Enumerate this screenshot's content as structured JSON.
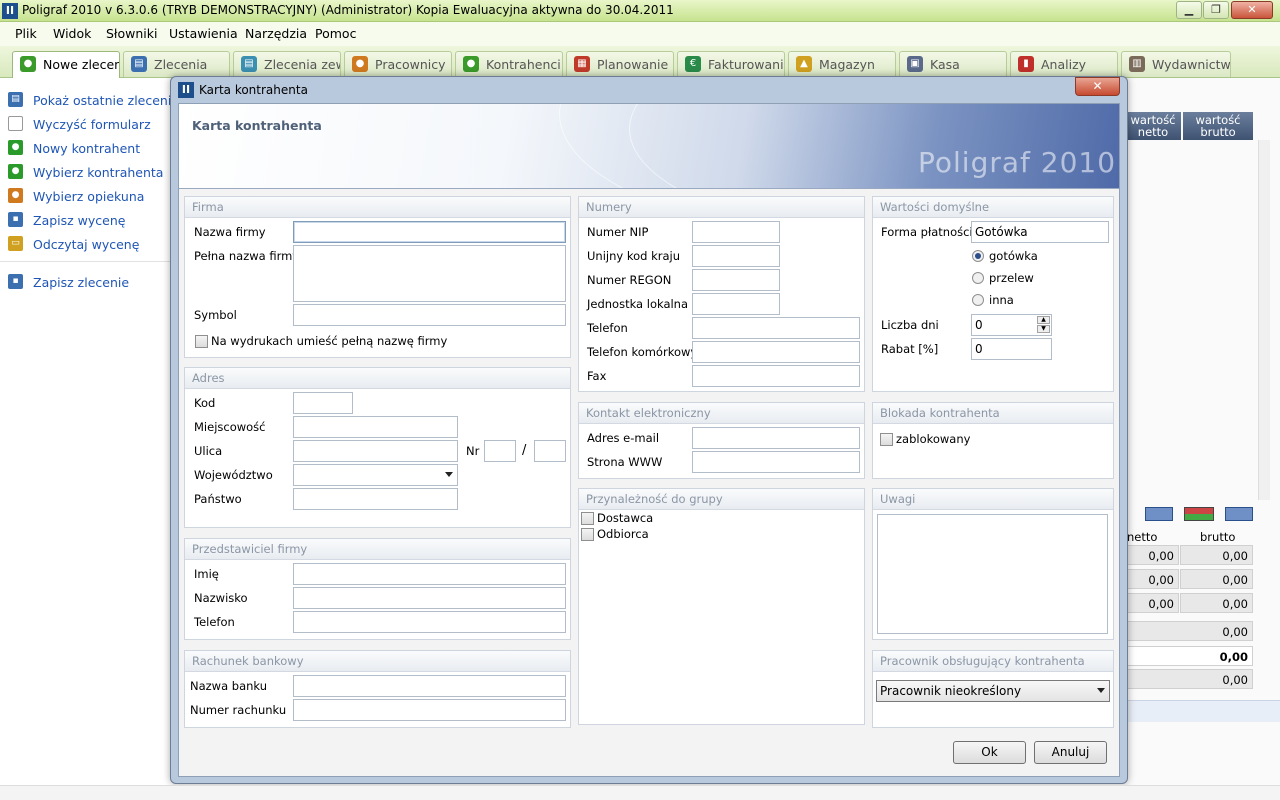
{
  "window": {
    "title": "Poligraf 2010 v 6.3.0.6 (TRYB DEMONSTRACYJNY) (Administrator) Kopia Ewaluacyjna aktywna do 30.04.2011",
    "app_icon": "II",
    "minimize": "▁",
    "maximize": "❐",
    "close": "✕"
  },
  "menu": [
    "Plik",
    "Widok",
    "Słowniki",
    "Ustawienia",
    "Narzędzia",
    "Pomoc"
  ],
  "tabs": [
    {
      "label": "Nowe zlecenie",
      "icon": "people-icon",
      "color": "#3a9a2a"
    },
    {
      "label": "Zlecenia",
      "icon": "documents-icon",
      "color": "#3b6fb0"
    },
    {
      "label": "Zlecenia zewn.",
      "icon": "external-documents-icon",
      "color": "#3b8fb0"
    },
    {
      "label": "Pracownicy",
      "icon": "workers-icon",
      "color": "#d07a20"
    },
    {
      "label": "Kontrahenci",
      "icon": "contractors-icon",
      "color": "#3a9a2a"
    },
    {
      "label": "Planowanie",
      "icon": "planning-icon",
      "color": "#c03a2a"
    },
    {
      "label": "Fakturowanie",
      "icon": "invoice-icon",
      "color": "#2a8a4a"
    },
    {
      "label": "Magazyn",
      "icon": "warehouse-icon",
      "color": "#d0a020"
    },
    {
      "label": "Kasa",
      "icon": "cash-icon",
      "color": "#5a6a8a"
    },
    {
      "label": "Analizy",
      "icon": "chart-icon",
      "color": "#c0302a"
    },
    {
      "label": "Wydawnictwo",
      "icon": "book-icon",
      "color": "#7a6a5a"
    }
  ],
  "sidebar": [
    {
      "label": "Pokaż ostatnie zlecenie",
      "icon": "recent-documents-icon",
      "color": "#3b6fb0"
    },
    {
      "label": "Wyczyść formularz",
      "icon": "blank-page-icon",
      "color": "#ffffff"
    },
    {
      "label": "Nowy kontrahent",
      "icon": "person-icon",
      "color": "#2a9a2a"
    },
    {
      "label": "Wybierz kontrahenta",
      "icon": "people-icon",
      "color": "#2a9a2a"
    },
    {
      "label": "Wybierz opiekuna",
      "icon": "workers-icon",
      "color": "#d07a20"
    },
    {
      "label": "Zapisz wycenę",
      "icon": "floppy-icon",
      "color": "#3b6fb0"
    },
    {
      "label": "Odczytaj wycenę",
      "icon": "open-folder-icon",
      "color": "#d0a020"
    },
    {
      "label": "Zapisz zlecenie",
      "icon": "floppy-icon",
      "color": "#3b6fb0"
    }
  ],
  "right_panel": {
    "col_netto": "wartość netto",
    "col_brutto": "wartość brutto",
    "sub_netto": "netto",
    "sub_brutto": "brutto",
    "rows": [
      {
        "netto": "0,00",
        "brutto": "0,00"
      },
      {
        "netto": "0,00",
        "brutto": "0,00"
      },
      {
        "netto": "0,00",
        "brutto": "0,00"
      },
      {
        "netto": "",
        "brutto": "0,00"
      },
      {
        "netto": "",
        "brutto": "0,00"
      },
      {
        "netto": "",
        "brutto": "0,00"
      }
    ]
  },
  "dialog": {
    "title": "Karta kontrahenta",
    "banner_title": "Karta kontrahenta",
    "banner_logo": "Poligraf 2010",
    "close": "✕",
    "ok": "Ok",
    "cancel": "Anuluj"
  },
  "firma": {
    "header": "Firma",
    "nazwa_label": "Nazwa firmy",
    "nazwa_value": "",
    "pelna_label": "Pełna nazwa firmy",
    "symbol_label": "Symbol",
    "print_full_label": "Na wydrukach umieść pełną nazwę firmy"
  },
  "adres": {
    "header": "Adres",
    "kod_label": "Kod",
    "miejscowosc_label": "Miejscowość",
    "ulica_label": "Ulica",
    "nr_label": "Nr",
    "slash": "/",
    "wojewodztwo_label": "Województwo",
    "panstwo_label": "Państwo"
  },
  "przedstawiciel": {
    "header": "Przedstawiciel firmy",
    "imie_label": "Imię",
    "nazwisko_label": "Nazwisko",
    "telefon_label": "Telefon"
  },
  "bank": {
    "header": "Rachunek bankowy",
    "nazwa_label": "Nazwa banku",
    "numer_label": "Numer rachunku"
  },
  "numery": {
    "header": "Numery",
    "nip_label": "Numer NIP",
    "kod_kraju_label": "Unijny kod kraju",
    "regon_label": "Numer REGON",
    "jednostka_label": "Jednostka lokalna",
    "telefon_label": "Telefon",
    "komorkowy_label": "Telefon komórkowy",
    "fax_label": "Fax"
  },
  "kontakt": {
    "header": "Kontakt elektroniczny",
    "email_label": "Adres e-mail",
    "www_label": "Strona WWW"
  },
  "grupa": {
    "header": "Przynależność do grupy",
    "dostawca": "Dostawca",
    "odbiorca": "Odbiorca"
  },
  "domyslne": {
    "header": "Wartości domyślne",
    "forma_label": "Forma płatności",
    "forma_value": "Gotówka",
    "opcja_gotowka": "gotówka",
    "opcja_przelew": "przelew",
    "opcja_inna": "inna",
    "liczba_dni_label": "Liczba dni",
    "liczba_dni_value": "0",
    "rabat_label": "Rabat [%]",
    "rabat_value": "0"
  },
  "blokada": {
    "header": "Blokada kontrahenta",
    "zablokowany": "zablokowany"
  },
  "uwagi": {
    "header": "Uwagi"
  },
  "pracownik": {
    "header": "Pracownik obsługujący kontrahenta",
    "value": "Pracownik nieokreślony"
  }
}
